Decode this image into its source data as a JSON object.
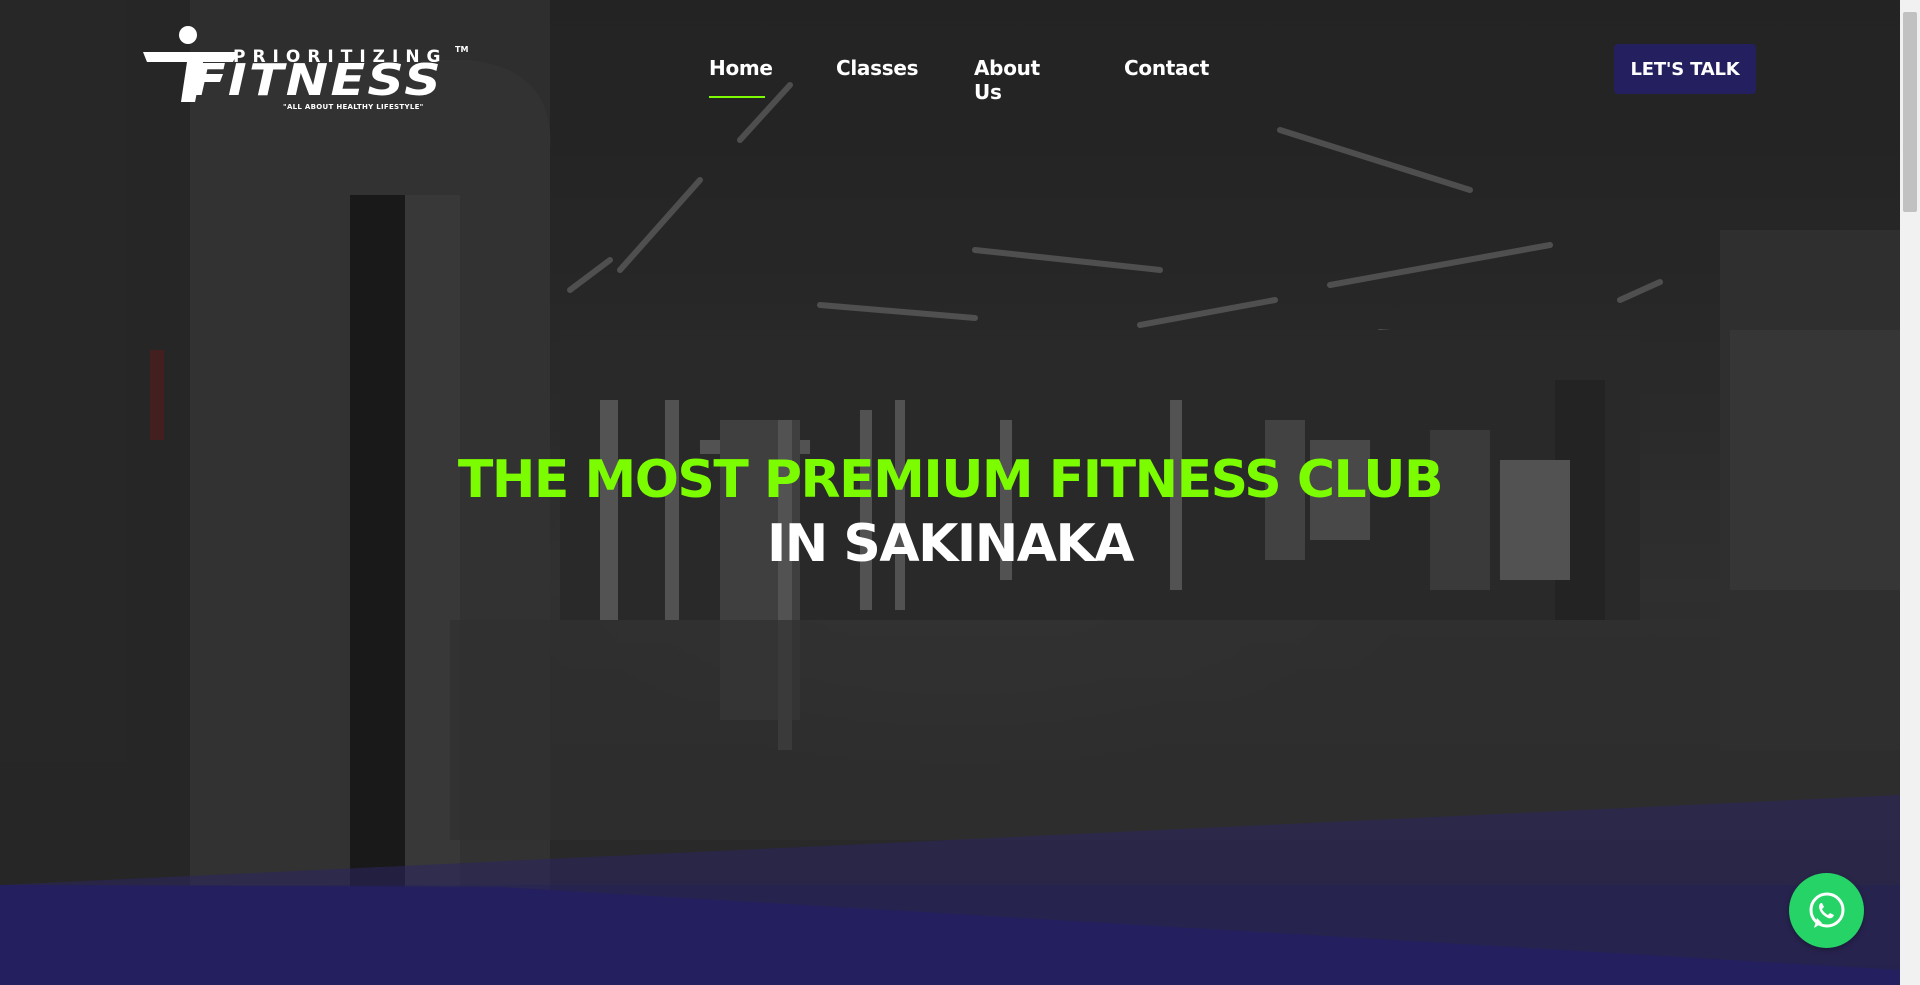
{
  "logo": {
    "top_word": "PRIORITIZING",
    "main_word": "FITNESS",
    "trademark": "TM",
    "tagline": "\"ALL ABOUT HEALTHY LIFESTYLE\""
  },
  "nav": {
    "items": [
      {
        "label": "Home",
        "active": true
      },
      {
        "label": "Classes",
        "active": false
      },
      {
        "label": "About Us",
        "active": false
      },
      {
        "label": "Contact",
        "active": false
      }
    ]
  },
  "cta": {
    "label": "LET'S TALK"
  },
  "hero": {
    "line1": "THE MOST PREMIUM FITNESS CLUB",
    "line2": "IN SAKINAKA",
    "background_image": "dark gym interior with weight machines"
  },
  "colors": {
    "accent_green": "#7cfc00",
    "brand_purple": "#24205f",
    "whatsapp_green": "#25d366"
  },
  "icons": {
    "chat": "whatsapp-icon"
  }
}
